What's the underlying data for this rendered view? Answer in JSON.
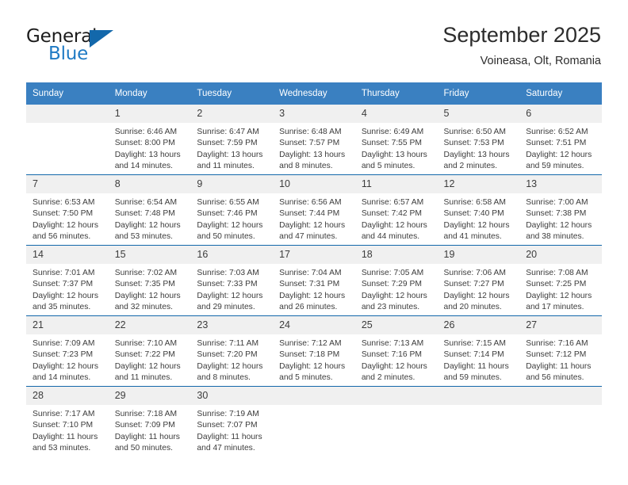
{
  "logo": {
    "part1": "General",
    "part2": "Blue",
    "triangle_color": "#1368ab",
    "blue_color": "#1f7ac4"
  },
  "header": {
    "title": "September 2025",
    "location": "Voineasa, Olt, Romania"
  },
  "theme": {
    "header_bg": "#3a80c1",
    "row_divider": "#1368ab",
    "daynum_bg": "#f0f0f0",
    "text": "#3c3c3c"
  },
  "weekday_headers": [
    "Sunday",
    "Monday",
    "Tuesday",
    "Wednesday",
    "Thursday",
    "Friday",
    "Saturday"
  ],
  "labels": {
    "sunrise_prefix": "Sunrise:",
    "sunset_prefix": "Sunset:",
    "daylight_prefix": "Daylight:"
  },
  "weeks": [
    [
      {
        "day": "",
        "empty": true
      },
      {
        "day": "1",
        "sunrise": "Sunrise: 6:46 AM",
        "sunset": "Sunset: 8:00 PM",
        "daylight1": "Daylight: 13 hours",
        "daylight2": "and 14 minutes."
      },
      {
        "day": "2",
        "sunrise": "Sunrise: 6:47 AM",
        "sunset": "Sunset: 7:59 PM",
        "daylight1": "Daylight: 13 hours",
        "daylight2": "and 11 minutes."
      },
      {
        "day": "3",
        "sunrise": "Sunrise: 6:48 AM",
        "sunset": "Sunset: 7:57 PM",
        "daylight1": "Daylight: 13 hours",
        "daylight2": "and 8 minutes."
      },
      {
        "day": "4",
        "sunrise": "Sunrise: 6:49 AM",
        "sunset": "Sunset: 7:55 PM",
        "daylight1": "Daylight: 13 hours",
        "daylight2": "and 5 minutes."
      },
      {
        "day": "5",
        "sunrise": "Sunrise: 6:50 AM",
        "sunset": "Sunset: 7:53 PM",
        "daylight1": "Daylight: 13 hours",
        "daylight2": "and 2 minutes."
      },
      {
        "day": "6",
        "sunrise": "Sunrise: 6:52 AM",
        "sunset": "Sunset: 7:51 PM",
        "daylight1": "Daylight: 12 hours",
        "daylight2": "and 59 minutes."
      }
    ],
    [
      {
        "day": "7",
        "sunrise": "Sunrise: 6:53 AM",
        "sunset": "Sunset: 7:50 PM",
        "daylight1": "Daylight: 12 hours",
        "daylight2": "and 56 minutes."
      },
      {
        "day": "8",
        "sunrise": "Sunrise: 6:54 AM",
        "sunset": "Sunset: 7:48 PM",
        "daylight1": "Daylight: 12 hours",
        "daylight2": "and 53 minutes."
      },
      {
        "day": "9",
        "sunrise": "Sunrise: 6:55 AM",
        "sunset": "Sunset: 7:46 PM",
        "daylight1": "Daylight: 12 hours",
        "daylight2": "and 50 minutes."
      },
      {
        "day": "10",
        "sunrise": "Sunrise: 6:56 AM",
        "sunset": "Sunset: 7:44 PM",
        "daylight1": "Daylight: 12 hours",
        "daylight2": "and 47 minutes."
      },
      {
        "day": "11",
        "sunrise": "Sunrise: 6:57 AM",
        "sunset": "Sunset: 7:42 PM",
        "daylight1": "Daylight: 12 hours",
        "daylight2": "and 44 minutes."
      },
      {
        "day": "12",
        "sunrise": "Sunrise: 6:58 AM",
        "sunset": "Sunset: 7:40 PM",
        "daylight1": "Daylight: 12 hours",
        "daylight2": "and 41 minutes."
      },
      {
        "day": "13",
        "sunrise": "Sunrise: 7:00 AM",
        "sunset": "Sunset: 7:38 PM",
        "daylight1": "Daylight: 12 hours",
        "daylight2": "and 38 minutes."
      }
    ],
    [
      {
        "day": "14",
        "sunrise": "Sunrise: 7:01 AM",
        "sunset": "Sunset: 7:37 PM",
        "daylight1": "Daylight: 12 hours",
        "daylight2": "and 35 minutes."
      },
      {
        "day": "15",
        "sunrise": "Sunrise: 7:02 AM",
        "sunset": "Sunset: 7:35 PM",
        "daylight1": "Daylight: 12 hours",
        "daylight2": "and 32 minutes."
      },
      {
        "day": "16",
        "sunrise": "Sunrise: 7:03 AM",
        "sunset": "Sunset: 7:33 PM",
        "daylight1": "Daylight: 12 hours",
        "daylight2": "and 29 minutes."
      },
      {
        "day": "17",
        "sunrise": "Sunrise: 7:04 AM",
        "sunset": "Sunset: 7:31 PM",
        "daylight1": "Daylight: 12 hours",
        "daylight2": "and 26 minutes."
      },
      {
        "day": "18",
        "sunrise": "Sunrise: 7:05 AM",
        "sunset": "Sunset: 7:29 PM",
        "daylight1": "Daylight: 12 hours",
        "daylight2": "and 23 minutes."
      },
      {
        "day": "19",
        "sunrise": "Sunrise: 7:06 AM",
        "sunset": "Sunset: 7:27 PM",
        "daylight1": "Daylight: 12 hours",
        "daylight2": "and 20 minutes."
      },
      {
        "day": "20",
        "sunrise": "Sunrise: 7:08 AM",
        "sunset": "Sunset: 7:25 PM",
        "daylight1": "Daylight: 12 hours",
        "daylight2": "and 17 minutes."
      }
    ],
    [
      {
        "day": "21",
        "sunrise": "Sunrise: 7:09 AM",
        "sunset": "Sunset: 7:23 PM",
        "daylight1": "Daylight: 12 hours",
        "daylight2": "and 14 minutes."
      },
      {
        "day": "22",
        "sunrise": "Sunrise: 7:10 AM",
        "sunset": "Sunset: 7:22 PM",
        "daylight1": "Daylight: 12 hours",
        "daylight2": "and 11 minutes."
      },
      {
        "day": "23",
        "sunrise": "Sunrise: 7:11 AM",
        "sunset": "Sunset: 7:20 PM",
        "daylight1": "Daylight: 12 hours",
        "daylight2": "and 8 minutes."
      },
      {
        "day": "24",
        "sunrise": "Sunrise: 7:12 AM",
        "sunset": "Sunset: 7:18 PM",
        "daylight1": "Daylight: 12 hours",
        "daylight2": "and 5 minutes."
      },
      {
        "day": "25",
        "sunrise": "Sunrise: 7:13 AM",
        "sunset": "Sunset: 7:16 PM",
        "daylight1": "Daylight: 12 hours",
        "daylight2": "and 2 minutes."
      },
      {
        "day": "26",
        "sunrise": "Sunrise: 7:15 AM",
        "sunset": "Sunset: 7:14 PM",
        "daylight1": "Daylight: 11 hours",
        "daylight2": "and 59 minutes."
      },
      {
        "day": "27",
        "sunrise": "Sunrise: 7:16 AM",
        "sunset": "Sunset: 7:12 PM",
        "daylight1": "Daylight: 11 hours",
        "daylight2": "and 56 minutes."
      }
    ],
    [
      {
        "day": "28",
        "sunrise": "Sunrise: 7:17 AM",
        "sunset": "Sunset: 7:10 PM",
        "daylight1": "Daylight: 11 hours",
        "daylight2": "and 53 minutes."
      },
      {
        "day": "29",
        "sunrise": "Sunrise: 7:18 AM",
        "sunset": "Sunset: 7:09 PM",
        "daylight1": "Daylight: 11 hours",
        "daylight2": "and 50 minutes."
      },
      {
        "day": "30",
        "sunrise": "Sunrise: 7:19 AM",
        "sunset": "Sunset: 7:07 PM",
        "daylight1": "Daylight: 11 hours",
        "daylight2": "and 47 minutes."
      },
      {
        "day": "",
        "empty": true
      },
      {
        "day": "",
        "empty": true
      },
      {
        "day": "",
        "empty": true
      },
      {
        "day": "",
        "empty": true
      }
    ]
  ]
}
